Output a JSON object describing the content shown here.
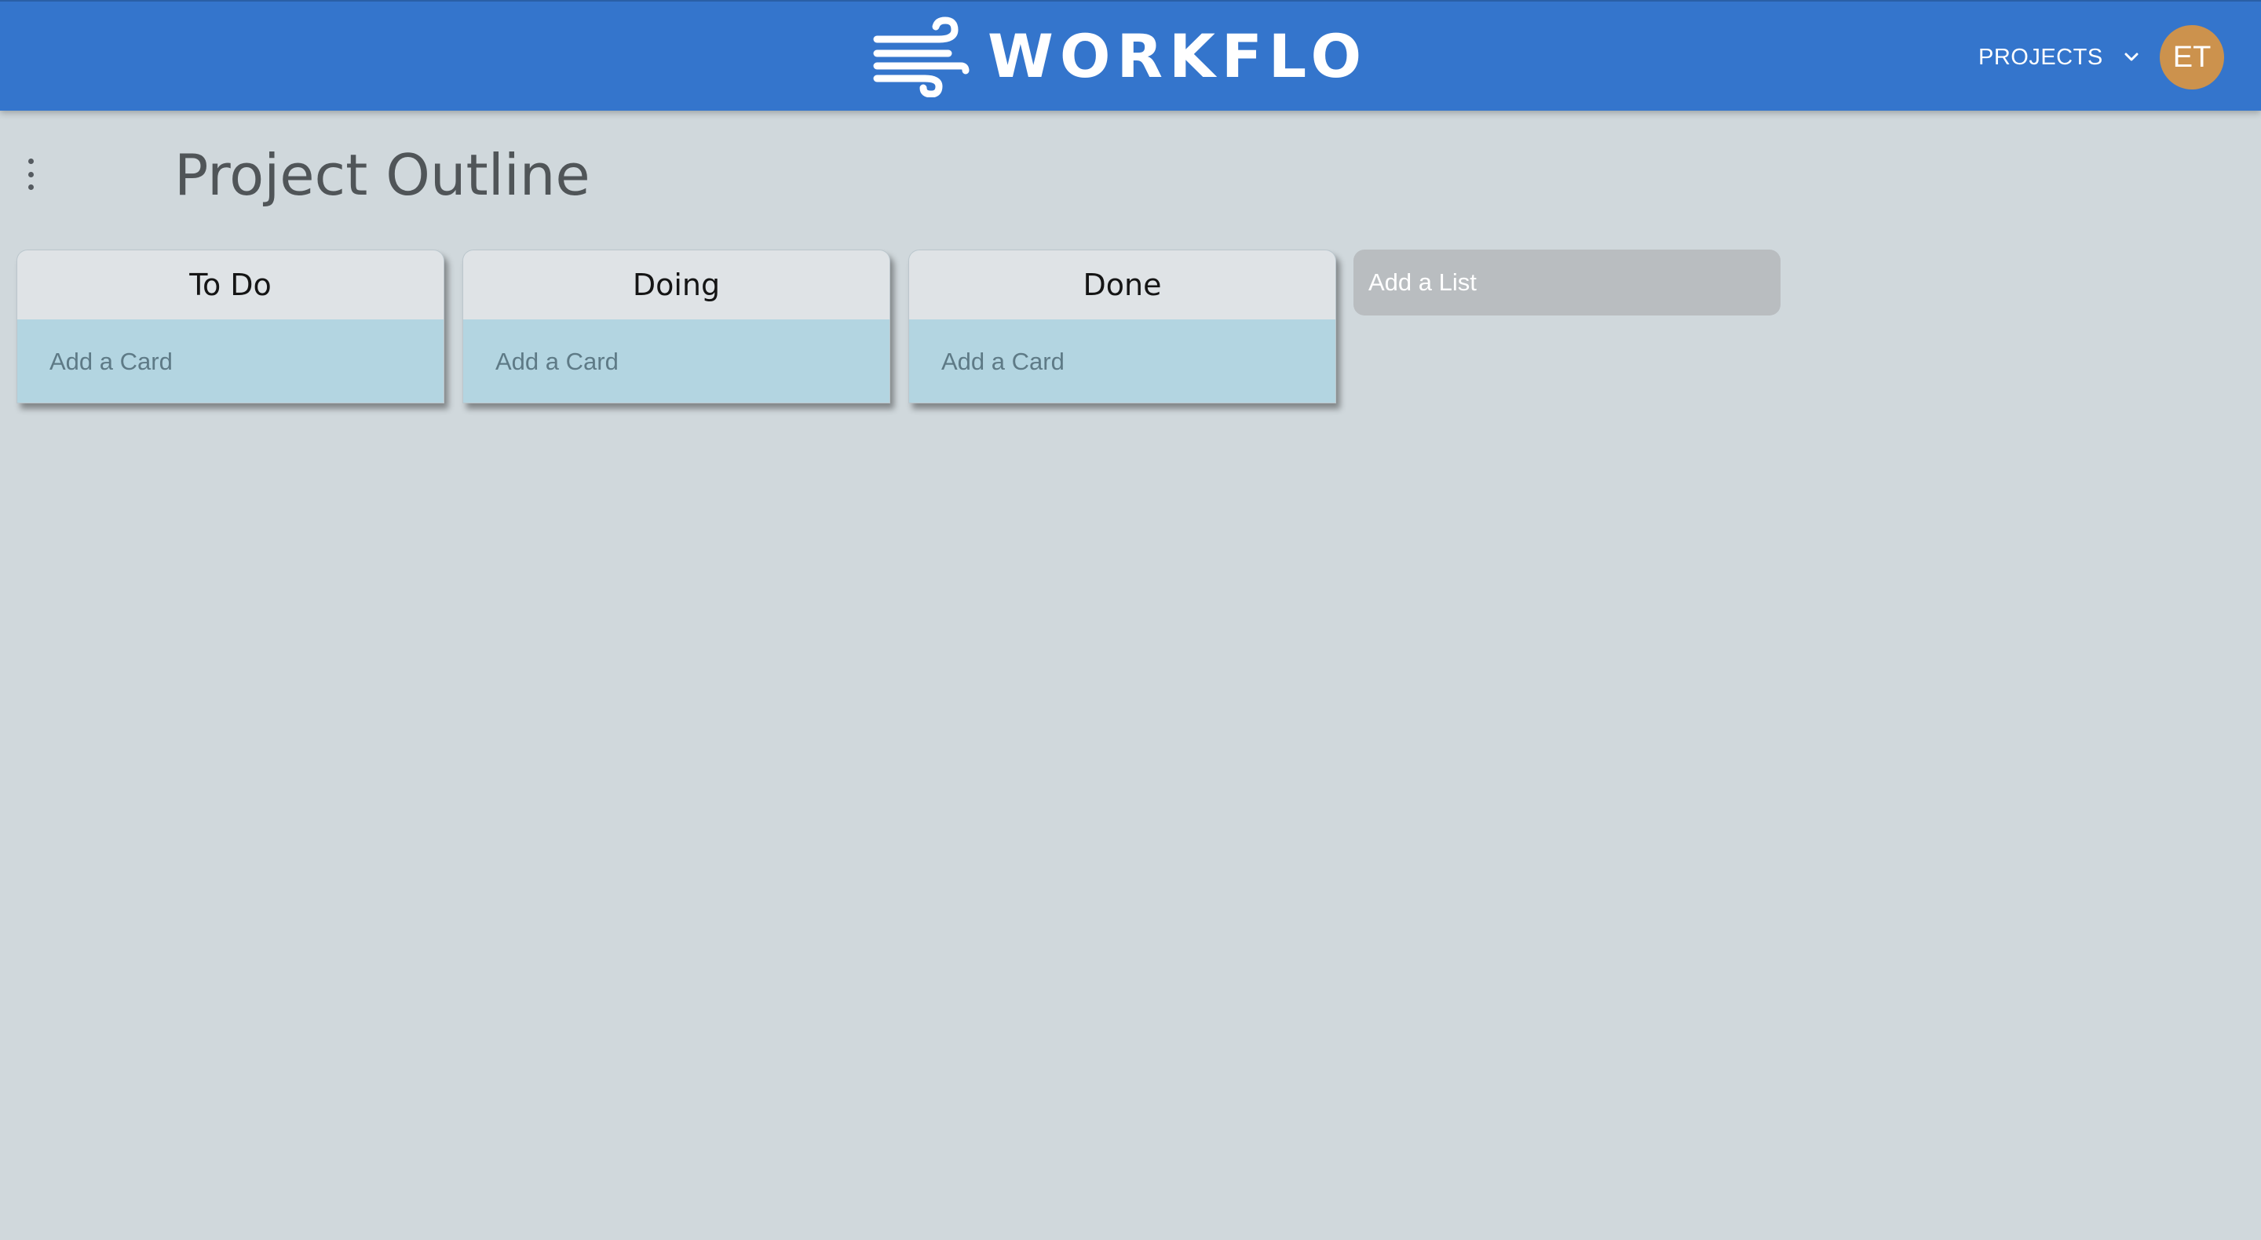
{
  "app": {
    "name": "WORKFLO",
    "logo_icon": "wind-icon"
  },
  "header": {
    "projects_label": "PROJECTS",
    "projects_icon": "chevron-down-icon",
    "avatar_initials": "ET",
    "bar_color": "#3475cc",
    "avatar_color": "#cc924d"
  },
  "board": {
    "title": "Project Outline",
    "menu_icon": "more-vertical-icon",
    "lists": [
      {
        "title": "To Do",
        "add_card_label": "Add a Card"
      },
      {
        "title": "Doing",
        "add_card_label": "Add a Card"
      },
      {
        "title": "Done",
        "add_card_label": "Add a Card"
      }
    ],
    "add_list_label": "Add a List",
    "card_area_color": "#b3d5e1",
    "background_color": "#d0d8dc"
  }
}
